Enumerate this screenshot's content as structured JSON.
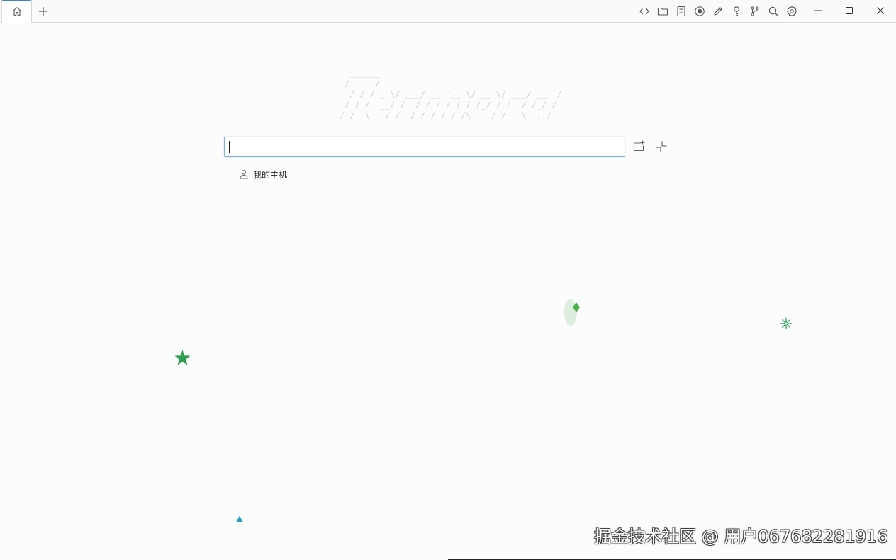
{
  "tabs": {
    "home_icon": "home-icon",
    "add_icon": "plus-icon"
  },
  "toolbar": {
    "icons": [
      "code-icon",
      "folder-icon",
      "document-icon",
      "record-icon",
      "pen-icon",
      "key-icon",
      "git-branch-icon",
      "search-icon",
      "gear-icon"
    ]
  },
  "window_controls": [
    "minimize-icon",
    "maximize-icon",
    "close-icon"
  ],
  "banner": {
    "ascii": "   ______\n  /_  __/__  _________ ___  ____  _________ _\n   / / / _ \\/ ___/ __ `__ \\/ __ \\/ ___/ __ `/\n  / / /  __/ /  / / / / / / /_/ / /  / /_/ /\n /_/  \\___/_/  /_/ /_/ /_/\\____/_/   \\__,_/"
  },
  "search": {
    "value": "",
    "placeholder": ""
  },
  "actions": {
    "new_session_icon": "new-window-plus-icon",
    "collapse_icon": "collapse-arrows-icon"
  },
  "hosts": [
    {
      "label": "我的主机",
      "icon": "user-icon"
    }
  ],
  "decorations": {
    "star_color": "#2e9e4f",
    "diamond_color": "#4caf50",
    "snowflake_color": "#3aa866",
    "triangle_color": "#2b9fc0"
  },
  "watermark": "掘金技术社区 @ 用户067682281916"
}
